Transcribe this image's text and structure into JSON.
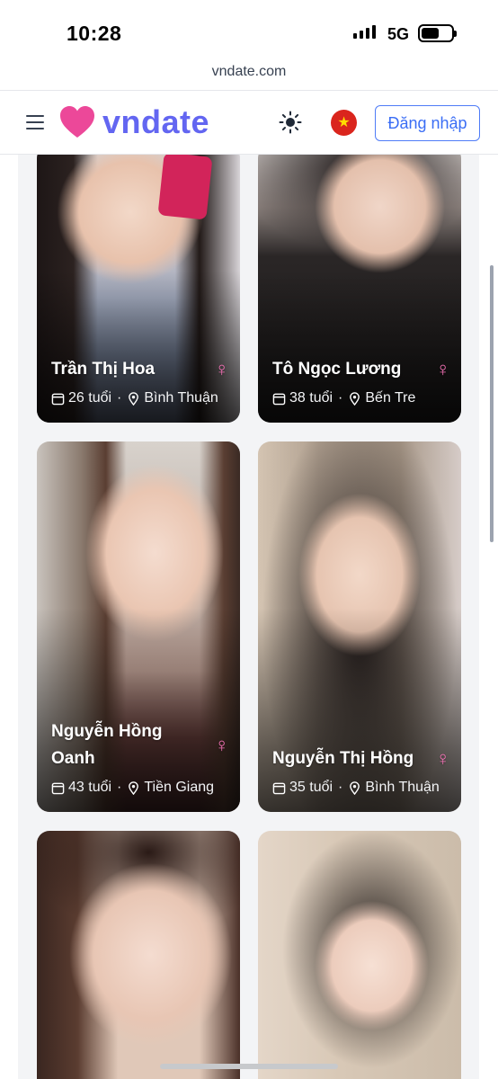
{
  "status_bar": {
    "time": "10:28",
    "network": "5G"
  },
  "browser": {
    "url": "vndate.com"
  },
  "header": {
    "logo_text": "vndate",
    "login_label": "Đăng nhập",
    "brand_color": "#6366f1",
    "heart_color": "#ec4899",
    "icons": [
      "menu-icon",
      "heart-logo-icon",
      "sun-icon",
      "vietnam-flag-icon"
    ]
  },
  "profiles": [
    {
      "name": "Trần Thị Hoa",
      "gender_symbol": "♀",
      "age": "26 tuổi",
      "location": "Bình Thuận"
    },
    {
      "name": "Tô Ngọc Lương",
      "gender_symbol": "♀",
      "age": "38 tuổi",
      "location": "Bến Tre"
    },
    {
      "name": "Nguyễn Hồng Oanh",
      "gender_symbol": "♀",
      "age": "43 tuổi",
      "location": "Tiền Giang"
    },
    {
      "name": "Nguyễn Thị Hồng",
      "gender_symbol": "♀",
      "age": "35 tuổi",
      "location": "Bình Thuận"
    },
    {
      "name": "",
      "gender_symbol": "",
      "age": "",
      "location": ""
    },
    {
      "name": "",
      "gender_symbol": "",
      "age": "",
      "location": ""
    }
  ],
  "meta_separator": "·"
}
